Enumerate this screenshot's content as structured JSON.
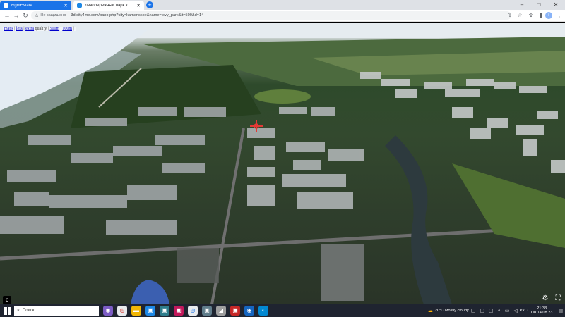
{
  "browser": {
    "tabs": [
      {
        "title": "RgmEstate",
        "color": "#ffffff"
      },
      {
        "title": "Левобережный парк kamenskoe",
        "color": "#1e88e5"
      }
    ],
    "new_tab": "+",
    "window_controls": {
      "minimize": "–",
      "maximize": "□",
      "close": "✕"
    },
    "security_label": "Не защищено",
    "url": "3d.city4me.com/pano.php?city=kamenskoe&name=levy_park&it=500&d=14",
    "profile_initial": "I"
  },
  "pano": {
    "links": [
      "maps",
      "less",
      "extra"
    ],
    "quality_label": "quality",
    "quality_options": [
      "500m",
      "100m"
    ],
    "marker_color": "#e53935"
  },
  "taskbar": {
    "search_placeholder": "Поиск",
    "weather": "20°C  Mostly cloudy",
    "language": "РУС",
    "time": "21:33",
    "date": "Пн 14.08.23"
  },
  "accent": "#1a73e8"
}
